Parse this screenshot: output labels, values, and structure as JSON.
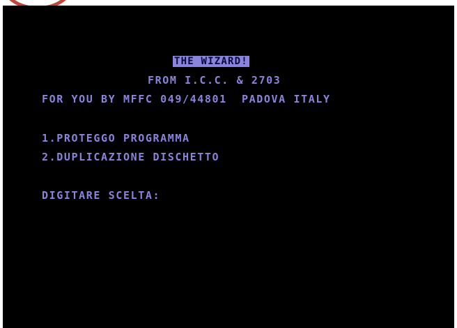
{
  "screen": {
    "title": "THE WIZARD!",
    "from_line": "FROM I.C.C. & 2703",
    "for_line": "FOR YOU BY MFFC 049/44801  PADOVA ITALY",
    "menu": [
      {
        "label": "1.PROTEGGO PROGRAMMA"
      },
      {
        "label": "2.DUPLICAZIONE DISCHETTO"
      }
    ],
    "prompt": "DIGITARE SCELTA:"
  },
  "colors": {
    "background": "#000000",
    "text": "#8a84dc",
    "title_text": "#0a0a3a",
    "frame": "#ffffff",
    "corner_mark": "#c0453a"
  }
}
